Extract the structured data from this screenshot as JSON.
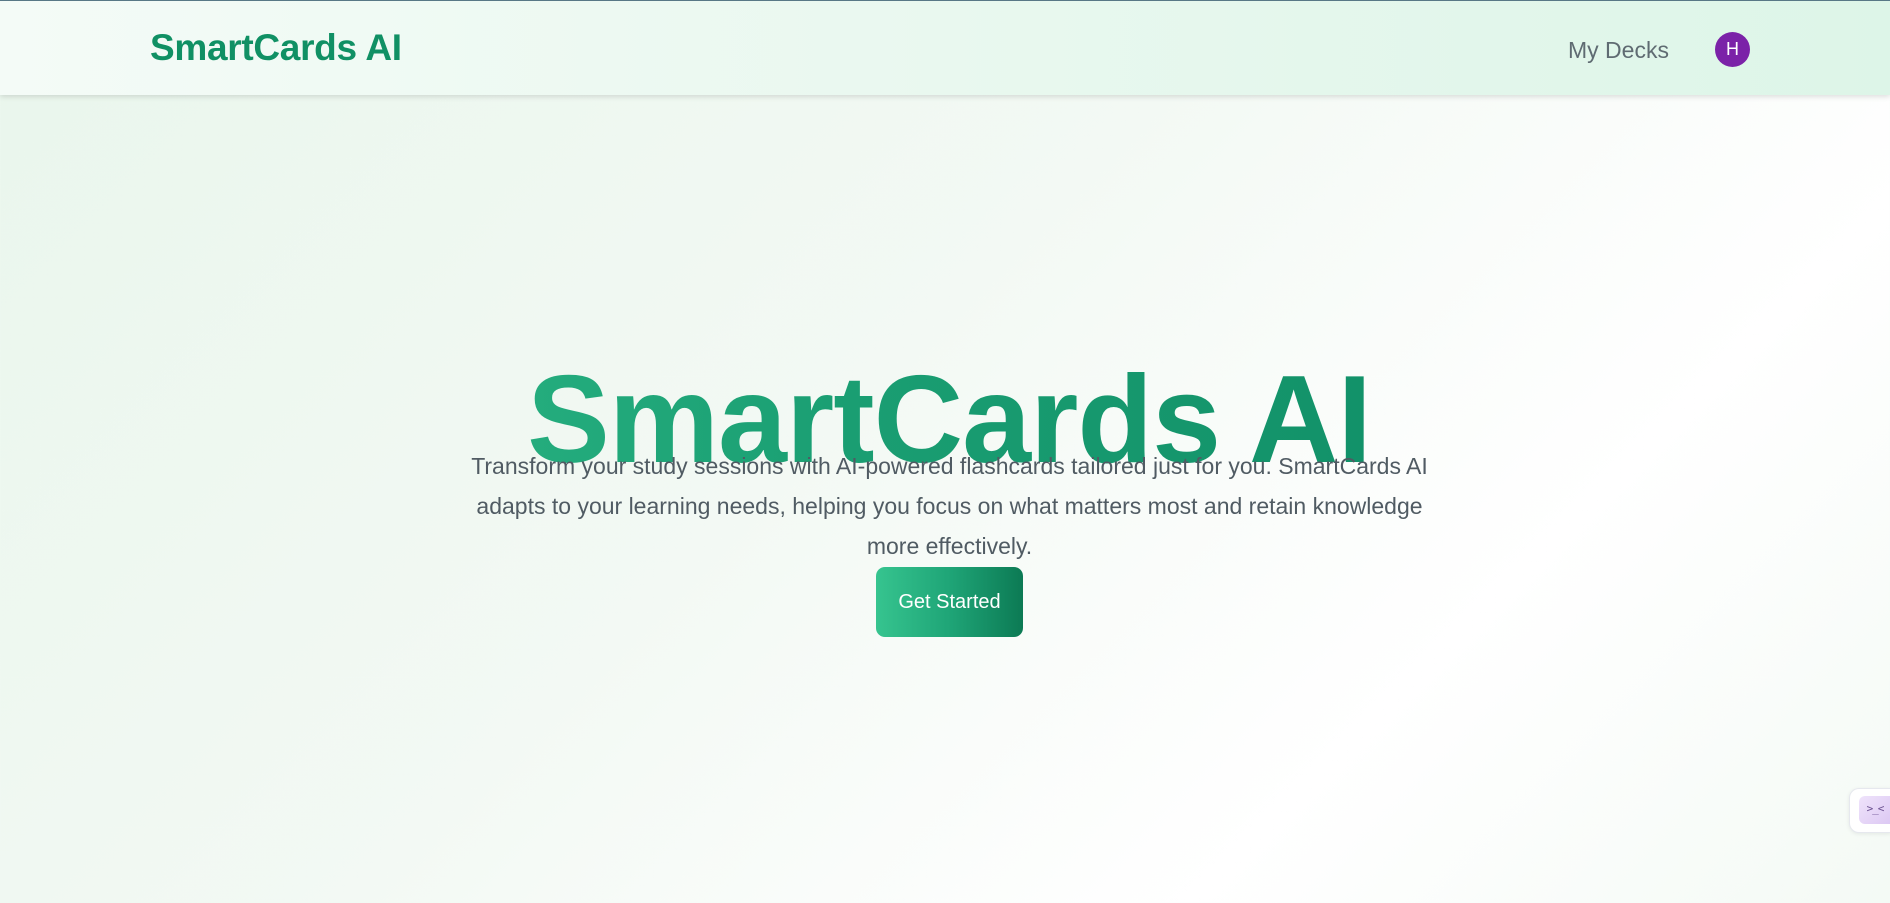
{
  "navbar": {
    "brand": "SmartCards AI",
    "my_decks_label": "My Decks",
    "avatar_initial": "H"
  },
  "hero": {
    "title": "SmartCards AI",
    "description": "Transform your study sessions with AI-powered flashcards tailored just for you. SmartCards AI adapts to your learning needs, helping you focus on what matters most and retain knowledge more effectively.",
    "cta_label": "Get Started"
  },
  "side_widget": {
    "icon": "assistant-face-icon",
    "glyph": ">_<"
  },
  "colors": {
    "brand_green": "#109064",
    "gradient_start": "#34c38f",
    "gradient_end": "#0a8560",
    "avatar_purple": "#7b22a8",
    "body_text": "#505b63"
  }
}
